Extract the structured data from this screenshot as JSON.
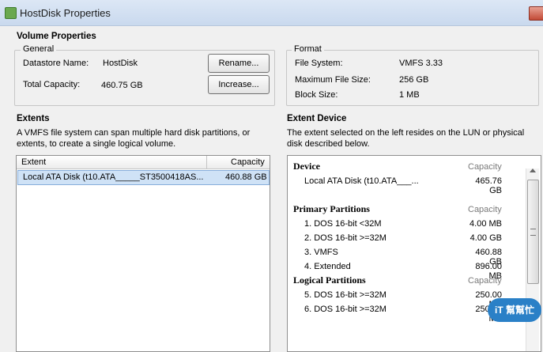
{
  "window": {
    "title": "HostDisk Properties"
  },
  "volume_properties": {
    "section_title": "Volume Properties",
    "general": {
      "legend": "General",
      "datastore_name_label": "Datastore Name:",
      "datastore_name_value": "HostDisk",
      "total_capacity_label": "Total Capacity:",
      "total_capacity_value": "460.75 GB",
      "rename_button": "Rename...",
      "increase_button": "Increase..."
    },
    "format": {
      "legend": "Format",
      "file_system_label": "File System:",
      "file_system_value": "VMFS 3.33",
      "max_file_size_label": "Maximum File Size:",
      "max_file_size_value": "256 GB",
      "block_size_label": "Block Size:",
      "block_size_value": "1 MB"
    }
  },
  "extents": {
    "section_title": "Extents",
    "description_line1": "A VMFS file system can span multiple hard disk partitions, or",
    "description_line2": "extents, to create a single logical volume.",
    "columns": {
      "extent": "Extent",
      "capacity": "Capacity"
    },
    "rows": [
      {
        "name": "Local ATA Disk (t10.ATA_____ST3500418AS...",
        "capacity": "460.88 GB"
      }
    ]
  },
  "extent_device": {
    "section_title": "Extent Device",
    "description_line1": "The extent selected on the left resides on the LUN or physical",
    "description_line2": "disk described below.",
    "device": {
      "heading": "Device",
      "capacity_header": "Capacity",
      "name": "Local ATA Disk (t10.ATA___...",
      "capacity": "465.76 GB"
    },
    "primary_partitions": {
      "heading": "Primary Partitions",
      "capacity_header": "Capacity",
      "items": [
        {
          "name": "1. DOS 16-bit <32M",
          "capacity": "4.00 MB"
        },
        {
          "name": "2. DOS 16-bit >=32M",
          "capacity": "4.00 GB"
        },
        {
          "name": "3. VMFS",
          "capacity": "460.88 GB"
        },
        {
          "name": "4. Extended",
          "capacity": "896.00 MB"
        }
      ]
    },
    "logical_partitions": {
      "heading": "Logical Partitions",
      "capacity_header": "Capacity",
      "items": [
        {
          "name": "5. DOS 16-bit >=32M",
          "capacity": "250.00 MB"
        },
        {
          "name": "6. DOS 16-bit >=32M",
          "capacity": "250.00 MB"
        }
      ]
    }
  },
  "watermark": {
    "text": "iT 幫幫忙"
  }
}
